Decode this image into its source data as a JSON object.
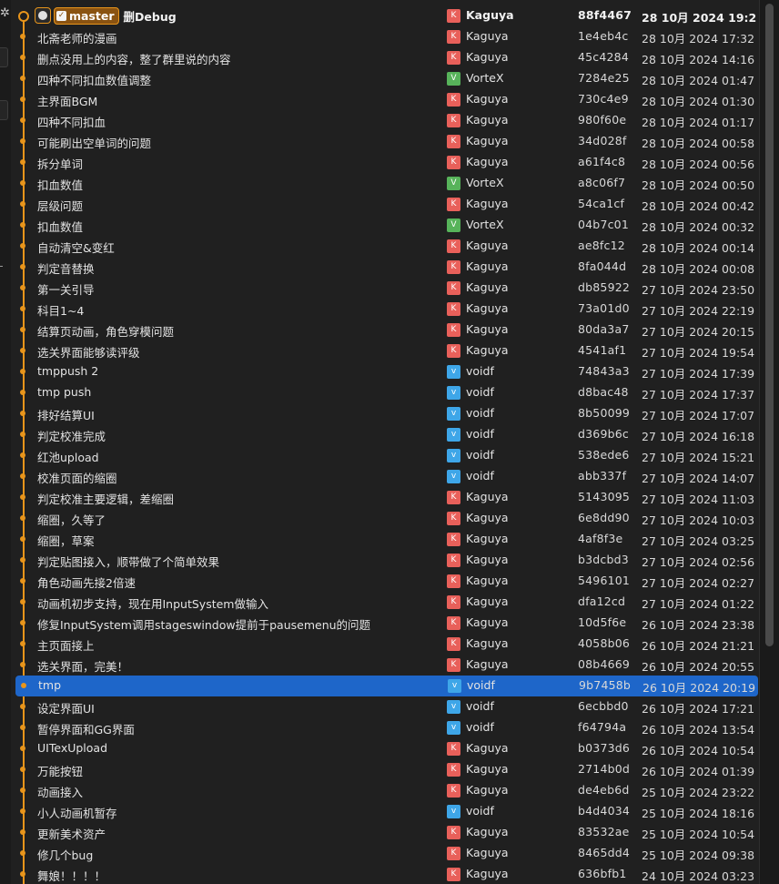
{
  "head": {
    "branch": "master",
    "message": "删Debug",
    "repo_icon": "github-icon",
    "check_icon": "check-icon"
  },
  "colors": {
    "graph": "#e8951b",
    "selected": "#1e66c9",
    "kaguya": "#e8605a",
    "vortex": "#57b35a",
    "voidf": "#3ea6e8"
  },
  "commits": [
    {
      "message": "删Debug",
      "author": "Kaguya",
      "initial": "K",
      "hash": "88f4467",
      "date": "28 10月 2024 19:2",
      "head": true
    },
    {
      "message": "北斋老师的漫画",
      "author": "Kaguya",
      "initial": "K",
      "hash": "1e4eb4c",
      "date": "28 10月 2024 17:32"
    },
    {
      "message": "删点没用上的内容，整了群里说的内容",
      "author": "Kaguya",
      "initial": "K",
      "hash": "45c4284",
      "date": "28 10月 2024 14:16"
    },
    {
      "message": "四种不同扣血数值调整",
      "author": "VorteX",
      "initial": "V",
      "hash": "7284e25",
      "date": "28 10月 2024 01:47"
    },
    {
      "message": "主界面BGM",
      "author": "Kaguya",
      "initial": "K",
      "hash": "730c4e9",
      "date": "28 10月 2024 01:30"
    },
    {
      "message": "四种不同扣血",
      "author": "Kaguya",
      "initial": "K",
      "hash": "980f60e",
      "date": "28 10月 2024 01:17"
    },
    {
      "message": "可能刷出空单词的问题",
      "author": "Kaguya",
      "initial": "K",
      "hash": "34d028f",
      "date": "28 10月 2024 00:58"
    },
    {
      "message": "拆分单词",
      "author": "Kaguya",
      "initial": "K",
      "hash": "a61f4c8",
      "date": "28 10月 2024 00:56"
    },
    {
      "message": "扣血数值",
      "author": "VorteX",
      "initial": "V",
      "hash": "a8c06f7",
      "date": "28 10月 2024 00:50"
    },
    {
      "message": "层级问题",
      "author": "Kaguya",
      "initial": "K",
      "hash": "54ca1cf",
      "date": "28 10月 2024 00:42"
    },
    {
      "message": "扣血数值",
      "author": "VorteX",
      "initial": "V",
      "hash": "04b7c01",
      "date": "28 10月 2024 00:32"
    },
    {
      "message": "自动清空&变红",
      "author": "Kaguya",
      "initial": "K",
      "hash": "ae8fc12",
      "date": "28 10月 2024 00:14"
    },
    {
      "message": "判定音替换",
      "author": "Kaguya",
      "initial": "K",
      "hash": "8fa044d",
      "date": "28 10月 2024 00:08"
    },
    {
      "message": "第一关引导",
      "author": "Kaguya",
      "initial": "K",
      "hash": "db85922",
      "date": "27 10月 2024 23:50"
    },
    {
      "message": "科目1~4",
      "author": "Kaguya",
      "initial": "K",
      "hash": "73a01d0",
      "date": "27 10月 2024 22:19"
    },
    {
      "message": "结算页动画，角色穿模问题",
      "author": "Kaguya",
      "initial": "K",
      "hash": "80da3a7",
      "date": "27 10月 2024 20:15"
    },
    {
      "message": "选关界面能够读评级",
      "author": "Kaguya",
      "initial": "K",
      "hash": "4541af1",
      "date": "27 10月 2024 19:54"
    },
    {
      "message": "tmppush 2",
      "author": "voidf",
      "initial": "v",
      "hash": "74843a3",
      "date": "27 10月 2024 17:39"
    },
    {
      "message": "tmp push",
      "author": "voidf",
      "initial": "v",
      "hash": "d8bac48",
      "date": "27 10月 2024 17:37"
    },
    {
      "message": "排好结算UI",
      "author": "voidf",
      "initial": "v",
      "hash": "8b50099",
      "date": "27 10月 2024 17:07"
    },
    {
      "message": "判定校准完成",
      "author": "voidf",
      "initial": "v",
      "hash": "d369b6c",
      "date": "27 10月 2024 16:18"
    },
    {
      "message": "红池upload",
      "author": "voidf",
      "initial": "v",
      "hash": "538ede6",
      "date": "27 10月 2024 15:21"
    },
    {
      "message": "校准页面的缩圈",
      "author": "voidf",
      "initial": "v",
      "hash": "abb337f",
      "date": "27 10月 2024 14:07"
    },
    {
      "message": "判定校准主要逻辑，差缩圈",
      "author": "Kaguya",
      "initial": "K",
      "hash": "5143095",
      "date": "27 10月 2024 11:03"
    },
    {
      "message": "缩圈，久等了",
      "author": "Kaguya",
      "initial": "K",
      "hash": "6e8dd90",
      "date": "27 10月 2024 10:03"
    },
    {
      "message": "缩圈，草案",
      "author": "Kaguya",
      "initial": "K",
      "hash": "4af8f3e",
      "date": "27 10月 2024 03:25"
    },
    {
      "message": "判定贴图接入，顺带做了个简单效果",
      "author": "Kaguya",
      "initial": "K",
      "hash": "b3dcbd3",
      "date": "27 10月 2024 02:56"
    },
    {
      "message": "角色动画先接2倍速",
      "author": "Kaguya",
      "initial": "K",
      "hash": "5496101",
      "date": "27 10月 2024 02:27"
    },
    {
      "message": "动画机初步支持，现在用InputSystem做输入",
      "author": "Kaguya",
      "initial": "K",
      "hash": "dfa12cd",
      "date": "27 10月 2024 01:22"
    },
    {
      "message": "修复InputSystem调用stageswindow提前于pausemenu的问题",
      "author": "Kaguya",
      "initial": "K",
      "hash": "10d5f6e",
      "date": "26 10月 2024 23:38"
    },
    {
      "message": "主页面接上",
      "author": "Kaguya",
      "initial": "K",
      "hash": "4058b06",
      "date": "26 10月 2024 21:21"
    },
    {
      "message": "选关界面，完美！",
      "author": "Kaguya",
      "initial": "K",
      "hash": "08b4669",
      "date": "26 10月 2024 20:55"
    },
    {
      "message": "tmp",
      "author": "voidf",
      "initial": "v",
      "hash": "9b7458b",
      "date": "26 10月 2024 20:19",
      "selected": true
    },
    {
      "message": "设定界面UI",
      "author": "voidf",
      "initial": "v",
      "hash": "6ecbbd0",
      "date": "26 10月 2024 17:21"
    },
    {
      "message": "暂停界面和GG界面",
      "author": "voidf",
      "initial": "v",
      "hash": "f64794a",
      "date": "26 10月 2024 13:54"
    },
    {
      "message": "UITexUpload",
      "author": "Kaguya",
      "initial": "K",
      "hash": "b0373d6",
      "date": "26 10月 2024 10:54"
    },
    {
      "message": "万能按钮",
      "author": "Kaguya",
      "initial": "K",
      "hash": "2714b0d",
      "date": "26 10月 2024 01:39"
    },
    {
      "message": "动画接入",
      "author": "Kaguya",
      "initial": "K",
      "hash": "de4eb6d",
      "date": "25 10月 2024 23:22"
    },
    {
      "message": "小人动画机暂存",
      "author": "voidf",
      "initial": "v",
      "hash": "b4d4034",
      "date": "25 10月 2024 18:16"
    },
    {
      "message": "更新美术资产",
      "author": "Kaguya",
      "initial": "K",
      "hash": "83532ae",
      "date": "25 10月 2024 10:54"
    },
    {
      "message": "修几个bug",
      "author": "Kaguya",
      "initial": "K",
      "hash": "8465dd4",
      "date": "25 10月 2024 09:38"
    },
    {
      "message": "舞娘！！！！",
      "author": "Kaguya",
      "initial": "K",
      "hash": "636bfb1",
      "date": "24 10月 2024 03:23"
    }
  ]
}
